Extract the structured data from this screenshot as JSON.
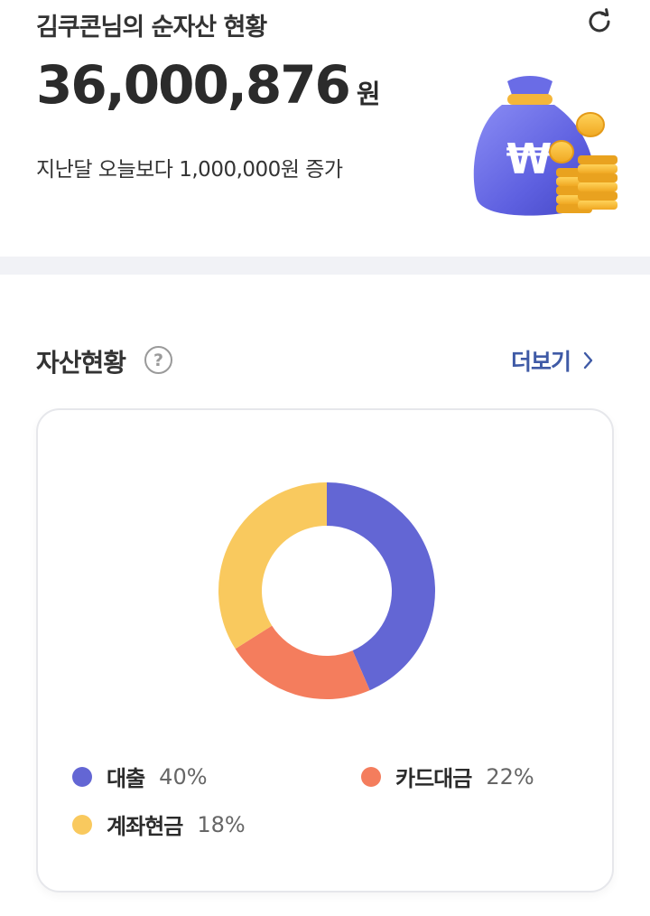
{
  "summary": {
    "title": "김쿠콘님의 순자산 현황",
    "amount": "36,000,876",
    "amount_unit": "원",
    "change_text": "지난달 오늘보다 1,000,000원 증가",
    "icons": {
      "refresh": "refresh-icon",
      "illustration": "money-bag-icon"
    }
  },
  "assets": {
    "title": "자산현황",
    "help_icon": "help-icon",
    "help_glyph": "?",
    "more_label": "더보기",
    "colors": {
      "loan": "#6366d4",
      "card_loan": "#f47d5d",
      "cash": "#f9c95e",
      "link": "#3f5aa6"
    }
  },
  "chart_data": {
    "type": "pie",
    "donut": true,
    "slices": [
      {
        "label": "대출",
        "percent_label": "40%",
        "share": 0.435,
        "color": "#6366d4"
      },
      {
        "label": "카드대금",
        "percent_label": "22%",
        "share": 0.225,
        "color": "#f47d5d"
      },
      {
        "label": "계좌현금",
        "percent_label": "18%",
        "share": 0.34,
        "color": "#f9c95e"
      }
    ]
  }
}
